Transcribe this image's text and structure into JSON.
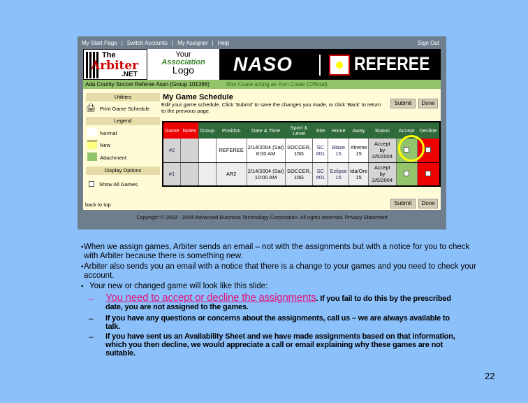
{
  "nav": {
    "items": [
      "My Start Page",
      "Switch Accounts",
      "My Assigner",
      "Help"
    ],
    "sign_out": "Sign Out"
  },
  "banner": {
    "arbiter_the": "The",
    "arbiter_name": "Arbiter",
    "arbiter_net": ".NET",
    "assoc_line1": "Your",
    "assoc_line2": "Association",
    "assoc_line3": "Logo",
    "naso": "NASO",
    "referee": "REFEREE"
  },
  "group_bar": {
    "group": "Ada County Soccer Referee Assn (Group 101366)",
    "user": "Ron Coate acting as Ron Coate (Official)"
  },
  "sidebar": {
    "utilities": "Utilities",
    "print": "Print Game Schedule",
    "legend": "Legend",
    "legend_items": [
      {
        "label": "Normal",
        "color": "#ffffff"
      },
      {
        "label": "New",
        "color": "#ffff80"
      },
      {
        "label": "Attachment",
        "color": "#93c46b"
      }
    ],
    "display_options": "Display Options",
    "show_all": "Show All Games",
    "back_to_top": "back to top"
  },
  "main": {
    "title": "My Game Schedule",
    "description": "Edit your game schedule. Click 'Submit' to save the changes you made, or click 'Back' to return to the previous page.",
    "submit": "Submit",
    "done": "Done"
  },
  "table": {
    "headers": [
      "Game",
      "Notes",
      "Group",
      "Position",
      "Date & Time",
      "Sport & Level",
      "Site",
      "Home",
      "Away",
      "Status",
      "Accept",
      "Decline"
    ],
    "rows": [
      {
        "game": "#2",
        "notes": "",
        "group": "",
        "position": "REFEREE",
        "date": "2/14/2004 (Sat)",
        "time": "8:00 AM",
        "sport": "SOCCER,",
        "level": "15G",
        "site1": "SC",
        "site2": "#01",
        "home1": "Blaze",
        "home2": "15",
        "away1": "Xtreme",
        "away2": "15",
        "status1": "Accept",
        "status2": "by",
        "status3": "2/5/2004"
      },
      {
        "game": "#1",
        "notes": "",
        "group": "",
        "position": "AR2",
        "date": "2/14/2004 (Sat)",
        "time": "10:00 AM",
        "sport": "SOCCER,",
        "level": "15G",
        "site1": "SC",
        "site2": "#01",
        "home1": "Eclipse",
        "home2": "15",
        "away1": "Ida/Ore",
        "away2": "15",
        "status1": "Accept",
        "status2": "by",
        "status3": "2/5/2004"
      }
    ]
  },
  "footer": "Copyright © 2003 - 2004 Advanced Business Technology Corporation. All rights reserved. Privacy Statement",
  "slide": {
    "bullets": [
      "When we assign games, Arbiter sends an email – not with the assignments but with a notice for you to check with Arbiter because there is something new.",
      "Arbiter also sends you an email with a notice that there is a change to your games and you need to check your account.",
      "Your new or changed game will look like this slide:"
    ],
    "sub_highlight": "You need to accept or decline the assignments",
    "sub1_rest": ". If you fail to do this by the prescribed   date, you are not assigned to the games.",
    "sub2": "If you have any questions or concerns about the assignments, call us – we are always available to talk.",
    "sub3": "If you have sent us an Availability Sheet and we have made assignments based on that information, which you then decline, we would appreciate a call or email explaining why these games are not suitable.",
    "page_number": "22"
  },
  "colors": {
    "background": "#8cc0fb",
    "highlight": "#e0147c",
    "accept": "#93c46b",
    "decline": "#ee0000"
  }
}
